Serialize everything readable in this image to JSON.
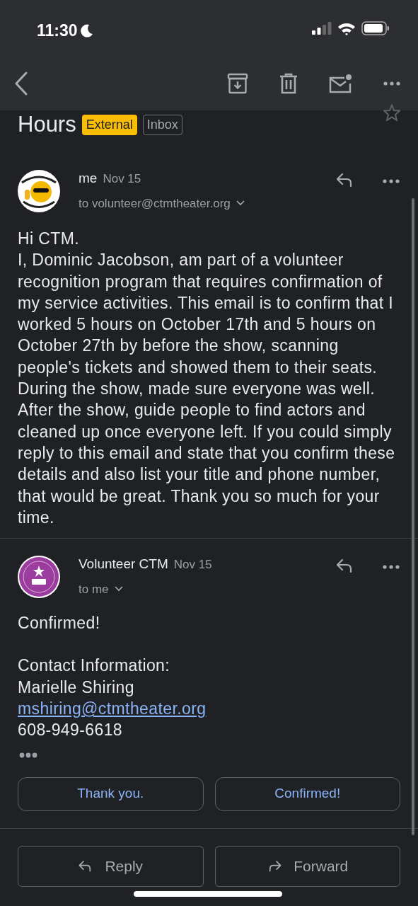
{
  "status_bar": {
    "time": "11:30"
  },
  "subject": {
    "text": "Hours",
    "starred": false,
    "labels": [
      {
        "text": "External",
        "kind": "warning"
      },
      {
        "text": "Inbox",
        "kind": "outline"
      }
    ]
  },
  "messages": [
    {
      "sender": "me",
      "date": "Nov 15",
      "recipients": "to volunteer@ctmtheater.org",
      "expanded": false,
      "lines": [
        {
          "kind": "text",
          "text": "Hi CTM."
        },
        {
          "kind": "text",
          "text": "I, Dominic Jacobson, am part of a volunteer recognition program that requires confirmation of my service activities. This email is to confirm that I worked 5 hours on October 17th and 5 hours on October 27th by before the show, scanning people's tickets and showed them to their seats. During the show, made sure everyone was well. After the show, guide people to find actors and cleaned up once everyone left. If you could simply reply to this email and state that you confirm these details and also list your title and phone number, that would be great. Thank you so much for your time."
        }
      ]
    },
    {
      "sender": "Volunteer CTM",
      "date": "Nov 15",
      "recipients": "to me",
      "expanded": false,
      "lines": [
        {
          "kind": "text",
          "text": "Confirmed!"
        },
        {
          "kind": "blank"
        },
        {
          "kind": "text",
          "text": "Contact Information:"
        },
        {
          "kind": "text",
          "text": "Marielle Shiring"
        },
        {
          "kind": "link",
          "text": "mshiring@ctmtheater.org"
        },
        {
          "kind": "text",
          "text": "608-949-6618"
        }
      ],
      "trimmed": true
    }
  ],
  "smart_replies": [
    "Thank you.",
    "Confirmed!"
  ],
  "actions": [
    {
      "kind": "reply",
      "label": "Reply"
    },
    {
      "kind": "forward",
      "label": "Forward"
    }
  ]
}
